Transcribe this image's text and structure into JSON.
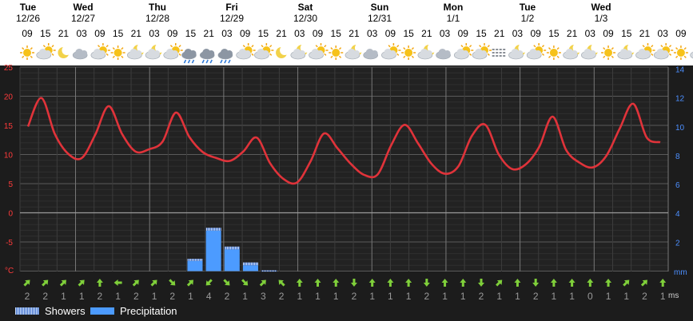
{
  "days": [
    {
      "weekday": "Tue",
      "date": "12/26"
    },
    {
      "weekday": "Wed",
      "date": "12/27"
    },
    {
      "weekday": "Thu",
      "date": "12/28"
    },
    {
      "weekday": "Fri",
      "date": "12/29"
    },
    {
      "weekday": "Sat",
      "date": "12/30"
    },
    {
      "weekday": "Sun",
      "date": "12/31"
    },
    {
      "weekday": "Mon",
      "date": "1/1"
    },
    {
      "weekday": "Tue",
      "date": "1/2"
    },
    {
      "weekday": "Wed",
      "date": "1/3"
    }
  ],
  "legend": {
    "showers": "Showers",
    "precipitation": "Precipitation"
  },
  "wind_unit": "ms",
  "colors": {
    "temperature": "#e0333a",
    "precipitation": "#4c9bff",
    "showers_stripe": "#cfe2ff",
    "wind_arrow": "#7fcf3a",
    "temp_axis": "#ff3b3b",
    "right_axis": "#4c8fff",
    "background": "#1c1c1c"
  },
  "chart_data": {
    "type": "line",
    "x": [
      "09",
      "15",
      "21",
      "03",
      "09",
      "15",
      "21",
      "03",
      "09",
      "15",
      "21",
      "03",
      "09",
      "15",
      "21",
      "03",
      "09",
      "15",
      "21",
      "03",
      "09",
      "15",
      "21",
      "03",
      "09",
      "15",
      "21",
      "03",
      "09",
      "15",
      "21",
      "03",
      "09",
      "15",
      "21",
      "03",
      "09",
      "15",
      "21",
      "03",
      "09",
      "15",
      "21",
      "03",
      "09",
      "15",
      "21",
      "03",
      "09",
      "15",
      "21",
      "03",
      "09",
      "15",
      "21",
      "03",
      "09",
      "15",
      "21",
      "03",
      "09",
      "15",
      "21",
      "03",
      "09",
      "15",
      "21",
      "03",
      "09",
      "15",
      "21",
      "03",
      "09",
      "15",
      "21",
      "03",
      "09",
      "15",
      "21",
      "03",
      "09",
      "15",
      "21"
    ],
    "hour_labels": [
      "09",
      "15",
      "21",
      "03",
      "09",
      "15",
      "21",
      "03",
      "09",
      "15",
      "21",
      "03",
      "09",
      "15",
      "21",
      "03",
      "09",
      "15",
      "21",
      "03",
      "09",
      "15",
      "21",
      "03",
      "09",
      "15",
      "21",
      "03",
      "09",
      "15",
      "21",
      "03",
      "09",
      "15",
      "21",
      "03",
      "09",
      "15",
      "21"
    ],
    "weather_icons": [
      "sun",
      "partly-cloudy",
      "moon",
      "cloudy",
      "partly-cloudy",
      "sun",
      "partly-cloudy-night",
      "partly-cloudy-night",
      "partly-cloudy",
      "cloud-rain",
      "cloud-rain",
      "cloud-rain",
      "partly-cloudy",
      "partly-cloudy",
      "moon",
      "partly-cloudy-night",
      "partly-cloudy",
      "sun",
      "partly-cloudy-night",
      "cloudy",
      "partly-cloudy",
      "sun",
      "partly-cloudy-night",
      "cloudy",
      "partly-cloudy",
      "partly-cloudy",
      "fog",
      "partly-cloudy-night",
      "partly-cloudy",
      "sun",
      "partly-cloudy-night",
      "partly-cloudy-night",
      "sun",
      "partly-cloudy-night",
      "partly-cloudy",
      "partly-cloudy",
      "sun",
      "partly-cloudy-night",
      "partly-cloudy"
    ],
    "temperature": {
      "name": "Temperature",
      "unit": "°C",
      "values": [
        14.8,
        19.7,
        13.5,
        10.1,
        9.4,
        13.4,
        18.3,
        13.5,
        10.5,
        10.9,
        12.2,
        17.2,
        13.0,
        10.4,
        9.4,
        8.9,
        10.5,
        12.9,
        8.5,
        5.8,
        5.2,
        8.8,
        13.6,
        11.1,
        8.4,
        6.5,
        6.6,
        11.6,
        15.1,
        11.9,
        8.4,
        6.7,
        8.0,
        13.2,
        15.1,
        10.0,
        7.5,
        8.3,
        11.3,
        16.5,
        10.8,
        8.6,
        7.8,
        9.8,
        14.5,
        18.7,
        12.9,
        12.1
      ]
    },
    "precipitation": {
      "name": "Precipitation",
      "unit": "mm",
      "values": [
        0,
        0,
        0,
        0,
        0,
        0,
        0,
        0,
        0,
        0,
        0,
        0,
        0,
        0,
        0,
        0,
        0,
        0,
        0,
        0,
        0,
        0,
        0,
        0,
        0,
        0,
        0,
        0,
        0,
        0,
        0,
        0,
        0,
        0,
        0,
        0,
        0,
        0,
        0,
        0,
        0,
        0,
        0,
        0,
        0,
        0,
        0
      ],
      "bars": [
        {
          "index": 9,
          "precip": 0.7,
          "showers": 0.15
        },
        {
          "index": 10,
          "precip": 2.8,
          "showers": 0.2
        },
        {
          "index": 11,
          "precip": 1.5,
          "showers": 0.2
        },
        {
          "index": 12,
          "precip": 0.4,
          "showers": 0.2
        },
        {
          "index": 13,
          "precip": 0.0,
          "showers": 0.05
        }
      ]
    },
    "wind": {
      "unit": "ms",
      "speeds": [
        2,
        2,
        1,
        1,
        2,
        1,
        2,
        1,
        2,
        1,
        4,
        2,
        1,
        3,
        2,
        1,
        1,
        1,
        2,
        1,
        1,
        1,
        2,
        1,
        1,
        2,
        1,
        1,
        2,
        1,
        1,
        0,
        1,
        1,
        2,
        1,
        1,
        0,
        1,
        1,
        2,
        1,
        1,
        0,
        1,
        1,
        3,
        1
      ],
      "directions": [
        "NE",
        "NE",
        "NE",
        "NE",
        "N",
        "W",
        "NE",
        "NE",
        "SE",
        "NE",
        "SW",
        "SE",
        "SE",
        "NE",
        "NW",
        "N",
        "N",
        "N",
        "S",
        "N",
        "N",
        "N",
        "S",
        "N",
        "N",
        "S",
        "NE",
        "N",
        "S",
        "N",
        "N",
        "N",
        "N",
        "NE",
        "NE",
        "N",
        "N",
        "S",
        "N",
        "N",
        "S",
        "N",
        "NE",
        "N",
        "NE",
        "NW",
        "NE"
      ]
    },
    "y_left": {
      "label": "°C",
      "min": -10,
      "max": 25,
      "ticks": [
        25,
        20,
        15,
        10,
        5,
        0,
        -5
      ]
    },
    "y_right": {
      "unit": "mm",
      "min": 0,
      "max": 14,
      "ticks": [
        14,
        12,
        10,
        8,
        6,
        4,
        2
      ]
    },
    "grid": true,
    "legend_position": "bottom-left"
  }
}
